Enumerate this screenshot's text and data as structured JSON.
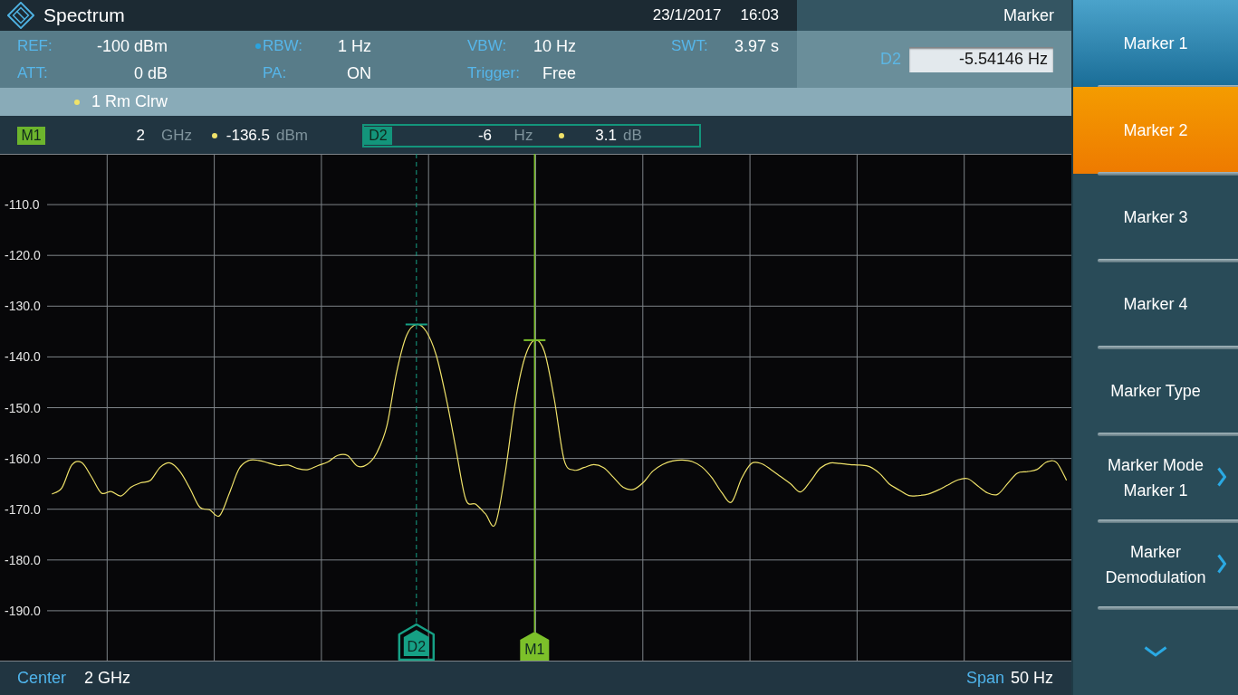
{
  "title_bar": {
    "title": "Spectrum",
    "date": "23/1/2017",
    "time": "16:03"
  },
  "settings": [
    {
      "label": "REF:",
      "value": "-100 dBm",
      "manual": false
    },
    {
      "label": "RBW:",
      "value": "1 Hz",
      "manual": true
    },
    {
      "label": "VBW:",
      "value": "10 Hz",
      "manual": false
    },
    {
      "label": "SWT:",
      "value": "3.97 s",
      "manual": false
    },
    {
      "label": "ATT:",
      "value": "0 dB",
      "manual": false
    },
    {
      "label": "PA:",
      "value": "ON",
      "manual": false
    },
    {
      "label": "Trigger:",
      "value": "Free",
      "manual": false
    }
  ],
  "marker_panel": {
    "title": "Marker",
    "field_label": "D2",
    "field_value": "-5.54146 Hz"
  },
  "marker_readouts": [
    {
      "label": "M1",
      "kind": "normal",
      "selected": false,
      "frequency": "2",
      "frequency_unit": "GHz",
      "power": "-136.5",
      "power_unit": "dBm"
    },
    {
      "label": "D2",
      "kind": "delta",
      "selected": true,
      "frequency": "-6",
      "frequency_unit": "Hz",
      "power": "3.1",
      "power_unit": "dB"
    }
  ],
  "chart": {
    "chart_data": {
      "type": "line",
      "grid": true,
      "categories": [
        null,
        null,
        null,
        null,
        null,
        null,
        null,
        null,
        null,
        null,
        null,
        null,
        null,
        null,
        null,
        null,
        null,
        null,
        null,
        null,
        null,
        null,
        null,
        null,
        null,
        null,
        null,
        null,
        null,
        null,
        null,
        null,
        null,
        null,
        null,
        null,
        null,
        null,
        null,
        null,
        null,
        null,
        null,
        null,
        null,
        null,
        null,
        null,
        null,
        null,
        null,
        null,
        null,
        null,
        null,
        null,
        null,
        null,
        null,
        null,
        null,
        null,
        null,
        null,
        null,
        null,
        null,
        null,
        null,
        null,
        null,
        null,
        null,
        null,
        null,
        null,
        null,
        null,
        null,
        null,
        null,
        null,
        null,
        null,
        null,
        null,
        null,
        null,
        null,
        null,
        null,
        null,
        null,
        null,
        null,
        null,
        null,
        null,
        null,
        null,
        null,
        null,
        null,
        null
      ],
      "ylim": [
        -200,
        -100
      ],
      "yticks": [
        {
          "value": -110,
          "label": "-110.0"
        },
        {
          "value": -120,
          "label": "-120.0"
        },
        {
          "value": -130,
          "label": "-130.0"
        },
        {
          "value": -140,
          "label": "-140.0"
        },
        {
          "value": -150,
          "label": "-150.0"
        },
        {
          "value": -160,
          "label": "-160.0"
        },
        {
          "value": -170,
          "label": "-170.0"
        },
        {
          "value": -180,
          "label": "-180.0"
        },
        {
          "value": -190,
          "label": "-190.0"
        }
      ],
      "series": [
        {
          "name": "1 Rm Clrw",
          "color": "#efe26a",
          "values": [
            -167.0,
            -165.8,
            -161.3,
            -160.8,
            -163.6,
            -166.8,
            -166.5,
            -167.4,
            -165.7,
            -164.8,
            -164.3,
            -161.7,
            -160.9,
            -162.6,
            -165.9,
            -169.6,
            -170.1,
            -171.3,
            -166.9,
            -162.0,
            -160.4,
            -160.4,
            -160.9,
            -161.4,
            -161.3,
            -162.0,
            -162.2,
            -161.4,
            -160.7,
            -159.4,
            -159.4,
            -161.5,
            -161.2,
            -158.8,
            -153.6,
            -142.9,
            -135.8,
            -133.6,
            -135.0,
            -139.6,
            -147.9,
            -158.0,
            -168.0,
            -169.0,
            -170.9,
            -173.0,
            -163.0,
            -149.2,
            -140.2,
            -136.7,
            -139.0,
            -148.4,
            -160.3,
            -162.3,
            -161.8,
            -161.2,
            -161.8,
            -163.7,
            -165.7,
            -166.1,
            -164.8,
            -162.5,
            -161.2,
            -160.5,
            -160.3,
            -160.6,
            -161.7,
            -163.8,
            -166.7,
            -168.6,
            -164.0,
            -161.0,
            -161.0,
            -162.2,
            -163.6,
            -165.0,
            -166.6,
            -164.5,
            -161.9,
            -160.9,
            -161.0,
            -161.2,
            -161.3,
            -161.6,
            -162.9,
            -165.0,
            -166.2,
            -167.3,
            -167.3,
            -167.0,
            -166.2,
            -165.2,
            -164.2,
            -164.0,
            -165.4,
            -166.8,
            -167.1,
            -165.0,
            -162.9,
            -162.6,
            -162.2,
            -160.7,
            -160.8,
            -164.3
          ]
        }
      ]
    },
    "markers": [
      {
        "label": "D2",
        "kind": "delta",
        "color": "#16a085"
      },
      {
        "label": "M1",
        "kind": "normal",
        "color": "#7cc02a"
      }
    ]
  },
  "status_bar": {
    "center_label": "Center",
    "center_value": "2 GHz",
    "span_label": "Span",
    "span_value": "50 Hz"
  },
  "softkeys": [
    {
      "lines": [
        "Marker 1"
      ],
      "selected": false,
      "highlighted": true,
      "submenu": false
    },
    {
      "lines": [
        "Marker 2"
      ],
      "selected": true,
      "highlighted": false,
      "submenu": false
    },
    {
      "lines": [
        "Marker 3"
      ],
      "selected": false,
      "highlighted": false,
      "submenu": false
    },
    {
      "lines": [
        "Marker 4"
      ],
      "selected": false,
      "highlighted": false,
      "submenu": false
    },
    {
      "lines": [
        "Marker Type"
      ],
      "selected": false,
      "highlighted": false,
      "submenu": false
    },
    {
      "lines": [
        "Marker Mode",
        "Marker 1"
      ],
      "selected": false,
      "highlighted": false,
      "submenu": true
    },
    {
      "lines": [
        "Marker",
        "Demodulation"
      ],
      "selected": false,
      "highlighted": false,
      "submenu": true
    }
  ]
}
